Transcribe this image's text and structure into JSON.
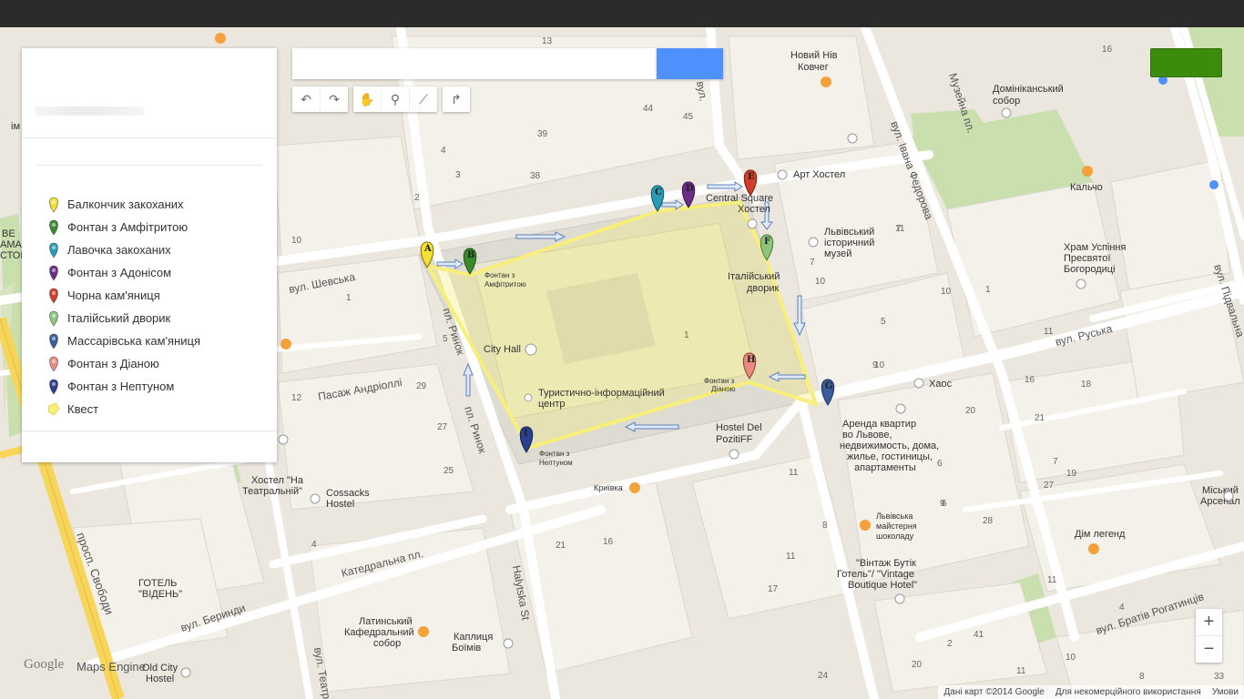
{
  "search": {
    "placeholder": "",
    "button_label": ""
  },
  "toolbar": {
    "undo": "↶",
    "redo": "↷",
    "hand": "✋",
    "marker": "⚲",
    "line": "⟋",
    "directions": "↱"
  },
  "panel": {
    "items": [
      {
        "label": "Балкончик закоханих",
        "letter": "A",
        "color": "#f2e12f"
      },
      {
        "label": "Фонтан з Амфітритою",
        "letter": "B",
        "color": "#3a8a2c"
      },
      {
        "label": "Лавочка закоханих",
        "letter": "C",
        "color": "#2a9bb5"
      },
      {
        "label": "Фонтан з Адонісом",
        "letter": "D",
        "color": "#6a2c86"
      },
      {
        "label": "Чорна кам'яниця",
        "letter": "E",
        "color": "#d23c2a"
      },
      {
        "label": "Італійський дворик",
        "letter": "F",
        "color": "#8cc47e"
      },
      {
        "label": "Массарівська кам'яниця",
        "letter": "G",
        "color": "#3b5c9a"
      },
      {
        "label": "Фонтан з Діаною",
        "letter": "H",
        "color": "#e88a80"
      },
      {
        "label": "Фонтан з Нептуном",
        "letter": "I",
        "color": "#2a3f8f"
      },
      {
        "label": "Квест",
        "letter": "",
        "color": "#f7ef7a"
      }
    ]
  },
  "map": {
    "streets": {
      "shevska": "вул. Шевська",
      "rynok_left": "пл. Ринок",
      "rynok_bottom": "пл. Ринок",
      "andriolli": "Пасаж Андріоллі",
      "katedralna": "Катедральна пл.",
      "beryndy": "вул. Беринди",
      "svobody": "просп. Свободи",
      "halytska": "Halytska St",
      "ruska": "вул. Руська",
      "fedorova": "вул. Івана Федорова",
      "muzeina": "Музейна пл.",
      "pidvalna": "вул. Підвальна",
      "rohatyntsiv": "вул. Братів Рогатинців",
      "ruka": "вул.",
      "teatr": "вул. Театр"
    },
    "places": {
      "noviy": "Новий Нів",
      "kovcheg": "Ковчег",
      "dominican1": "Домініканський",
      "dominican2": "собор",
      "art_hostel": "Арт Хостел",
      "central1": "Central Square",
      "central2": "Хостел",
      "lviv_ist1": "Львівський",
      "lviv_ist2": "історичний",
      "lviv_ist3": "музей",
      "kalcho": "Кальчо",
      "uspinnia1": "Храм Успіння",
      "uspinnia2": "Пресвятої",
      "uspinnia3": "Богородиці",
      "italian1": "Італійський",
      "italian2": "дворик",
      "fountain_amf1": "Фонтан з",
      "fountain_amf2": "Амфітритою",
      "city_hall": "City Hall",
      "tourist1": "Туристично-інформаційний",
      "tourist2": "центр",
      "fountain_dian1": "Фонтан з",
      "fountain_dian2": "Діаною",
      "fountain_nept1": "Фонтан з",
      "fountain_nept2": "Нептуном",
      "khaos": "Хаос",
      "arenda1": "Аренда квартир",
      "arenda2": "во Львове,",
      "arenda3": "недвижимость, дома,",
      "arenda4": "жилье, гостиницы,",
      "arenda5": "апартаменты",
      "del1": "Hostel Del",
      "del2": "PozitiFF",
      "kryivka": "Криївка",
      "teatralnyi1": "Хостел \"На",
      "teatralnyi2": "Театральній\"",
      "cossacks1": "Cossacks",
      "cossacks2": "Hostel",
      "chocolate1": "Львівська",
      "chocolate2": "майстерня",
      "chocolate3": "шоколаду",
      "vintage1": "\"Вінтаж Бутік",
      "vintage2": "Готель\"/ \"Vintage",
      "vintage3": "Boutique Hotel\"",
      "arsenal1": "Міський",
      "arsenal2": "Арсенал",
      "legend": "Дім легенд",
      "viden1": "ГОТЕЛЬ",
      "viden2": "\"ВІДЕНЬ\"",
      "latin1": "Латинський",
      "latin2": "Кафедральний",
      "latin3": "собор",
      "boim1": "Каплиця",
      "boim2": "Боїмів",
      "oldcity1": "Old City",
      "oldcity2": "Hostel",
      "left_cut1": "ВЕ",
      "left_cut2": "АМА",
      "left_cut3": "СТОІ",
      "left_top": "ім"
    },
    "numbers": [
      "16",
      "13",
      "2",
      "1",
      "44",
      "45",
      "39",
      "4",
      "3",
      "38",
      "10",
      "7",
      "10",
      "11",
      "1",
      "5",
      "1",
      "9",
      "7",
      "10",
      "10",
      "11",
      "5",
      "12",
      "29",
      "27",
      "25",
      "11",
      "6",
      "9",
      "16",
      "18",
      "21",
      "20",
      "19",
      "27",
      "28",
      "8",
      "6",
      "7",
      "11",
      "4",
      "21",
      "16",
      "17",
      "2",
      "11",
      "4",
      "10",
      "41",
      "8",
      "20",
      "33",
      "11",
      "24"
    ]
  },
  "pins": {
    "A": "A",
    "B": "B",
    "C": "C",
    "D": "D",
    "E": "E",
    "F": "F",
    "G": "G",
    "H": "H",
    "I": "I"
  },
  "zoom": {
    "in": "+",
    "out": "−"
  },
  "branding": {
    "google": "Google",
    "engine": "Maps Engine"
  },
  "footer": {
    "data": "Дані карт ©2014 Google",
    "noncommercial": "Для некомерційного використання",
    "terms": "Умови"
  }
}
